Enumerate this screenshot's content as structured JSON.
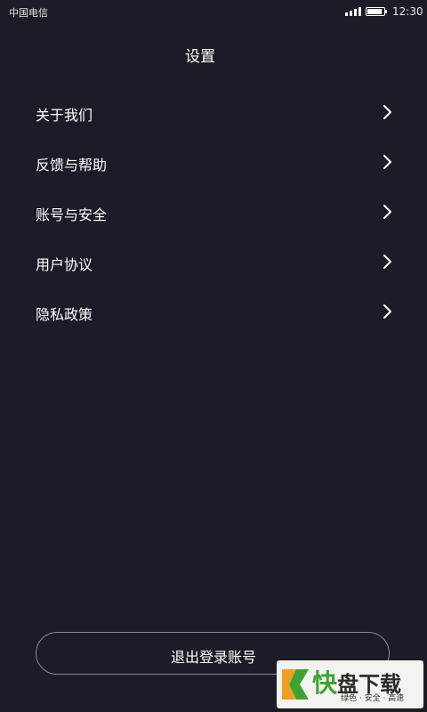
{
  "status_bar": {
    "carrier": "中国电信",
    "time": "12:30",
    "signal_icon": "signal-strength-icon",
    "battery_icon": "battery-icon",
    "battery_level": 0.9
  },
  "header": {
    "title": "设置"
  },
  "settings": {
    "items": [
      {
        "label": "关于我们",
        "icon": "chevron-right-icon"
      },
      {
        "label": "反馈与帮助",
        "icon": "chevron-right-icon"
      },
      {
        "label": "账号与安全",
        "icon": "chevron-right-icon"
      },
      {
        "label": "用户协议",
        "icon": "chevron-right-icon"
      },
      {
        "label": "隐私政策",
        "icon": "chevron-right-icon"
      }
    ]
  },
  "logout": {
    "label": "退出登录账号"
  },
  "watermark": {
    "title_accent": "快",
    "title_rest": "盘下载",
    "slogan": "绿色 · 安全 · 高速"
  },
  "colors": {
    "background": "#1c1c26",
    "text": "#ffffff",
    "button_border": "#8a8a92",
    "watermark_green": "#3fa333",
    "watermark_orange": "#f0a020"
  }
}
